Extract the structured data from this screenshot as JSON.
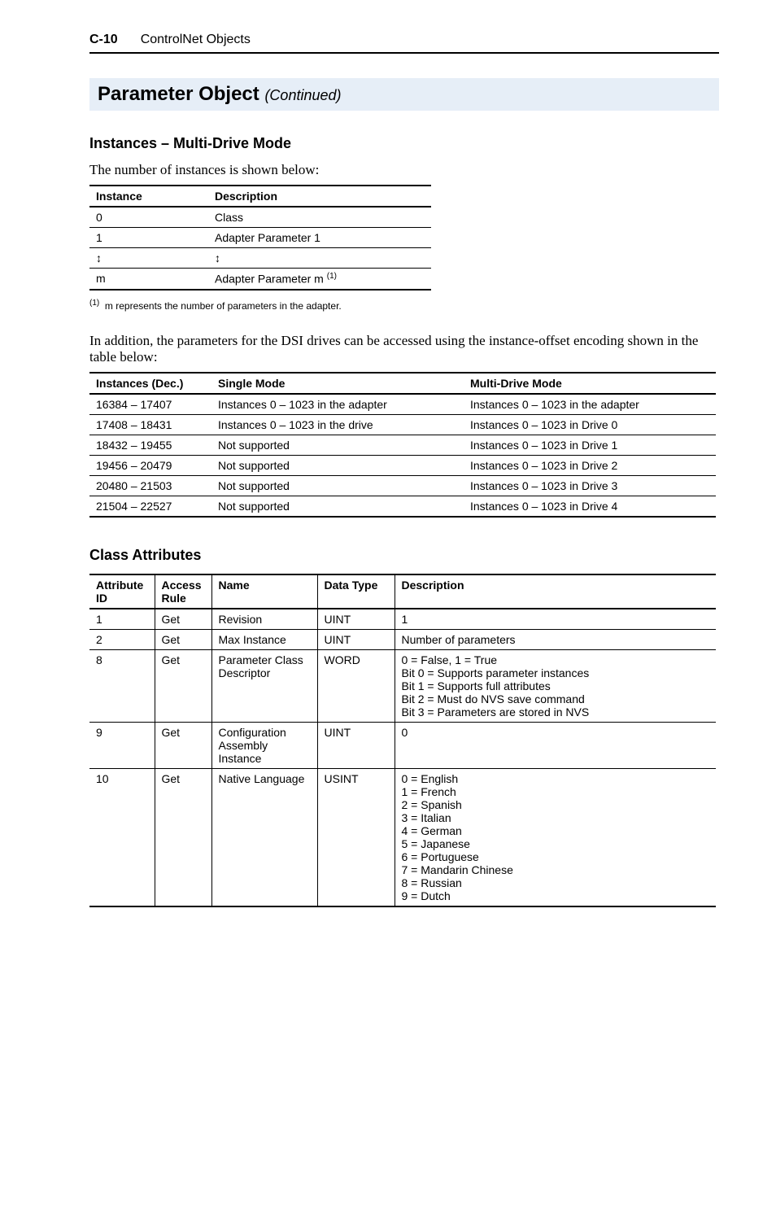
{
  "header": {
    "page_number": "C-10",
    "chapter_title": "ControlNet Objects"
  },
  "section": {
    "title": "Parameter Object",
    "continued": "(Continued)"
  },
  "instances_section": {
    "heading": "Instances – Multi-Drive Mode",
    "intro": "The number of instances is shown below:",
    "table": {
      "headers": [
        "Instance",
        "Description"
      ],
      "rows": [
        {
          "instance": "0",
          "desc": "Class"
        },
        {
          "instance": "1",
          "desc": "Adapter Parameter 1"
        },
        {
          "instance": "↕",
          "desc": "↕"
        },
        {
          "instance": "m",
          "desc_prefix": "Adapter Parameter m",
          "desc_sup": "(1)"
        }
      ]
    },
    "footnote_marker": "(1)",
    "footnote_text": "m represents the number of parameters in the adapter.",
    "between_text": "In addition, the parameters for the DSI drives can be accessed using the instance-offset encoding shown in the table below:",
    "table2": {
      "headers": [
        "Instances (Dec.)",
        "Single Mode",
        "Multi-Drive Mode"
      ],
      "rows": [
        {
          "c1": "16384 – 17407",
          "c2": "Instances 0 – 1023 in the adapter",
          "c3": "Instances 0 – 1023 in the adapter"
        },
        {
          "c1": "17408 – 18431",
          "c2": "Instances 0 – 1023 in the drive",
          "c3": "Instances 0 – 1023 in Drive 0"
        },
        {
          "c1": "18432 – 19455",
          "c2": "Not supported",
          "c3": "Instances 0 – 1023 in Drive 1"
        },
        {
          "c1": "19456 – 20479",
          "c2": "Not supported",
          "c3": "Instances 0 – 1023 in Drive 2"
        },
        {
          "c1": "20480 – 21503",
          "c2": "Not supported",
          "c3": "Instances 0 – 1023 in Drive 3"
        },
        {
          "c1": "21504 – 22527",
          "c2": "Not supported",
          "c3": "Instances 0 – 1023 in Drive 4"
        }
      ]
    }
  },
  "class_attributes": {
    "heading": "Class Attributes",
    "headers": [
      "Attribute ID",
      "Access Rule",
      "Name",
      "Data Type",
      "Description"
    ],
    "rows": [
      {
        "id": "1",
        "access": "Get",
        "name": "Revision",
        "dtype": "UINT",
        "desc": "1"
      },
      {
        "id": "2",
        "access": "Get",
        "name": "Max Instance",
        "dtype": "UINT",
        "desc": "Number of parameters"
      },
      {
        "id": "8",
        "access": "Get",
        "name": "Parameter Class Descriptor",
        "dtype": "WORD",
        "desc": "0 = False, 1 = True\nBit 0 = Supports parameter instances\nBit 1 = Supports full attributes\nBit 2 = Must do NVS save command\nBit 3 = Parameters are stored in NVS"
      },
      {
        "id": "9",
        "access": "Get",
        "name": "Configuration Assembly Instance",
        "dtype": "UINT",
        "desc": "0"
      },
      {
        "id": "10",
        "access": "Get",
        "name": "Native Language",
        "dtype": "USINT",
        "desc": "0 = English\n1 = French\n2 = Spanish\n3 = Italian\n4 = German\n5 = Japanese\n6 = Portuguese\n7 = Mandarin Chinese\n8 = Russian\n9 = Dutch"
      }
    ]
  }
}
